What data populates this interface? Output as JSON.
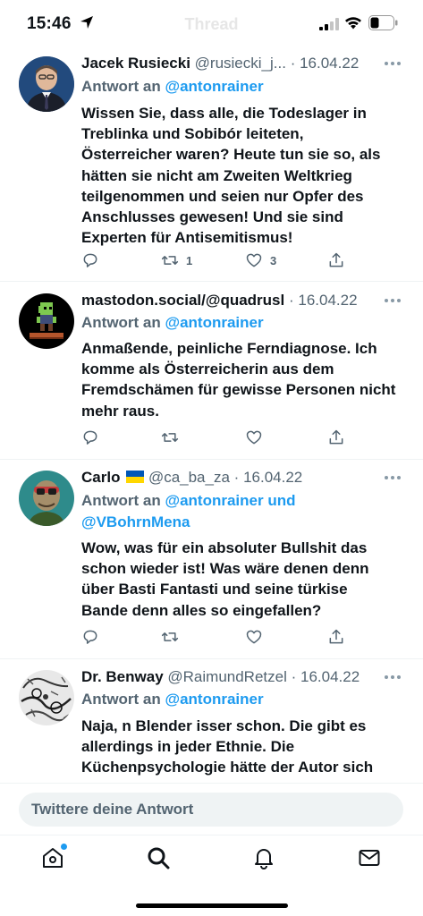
{
  "status_bar": {
    "time": "15:46",
    "ghost_title": "Thread"
  },
  "tweets": [
    {
      "name": "Jacek Rusiecki",
      "handle": "@rusiecki_j...",
      "separator": "·",
      "date": "16.04.22",
      "reply_prefix": "Antwort an",
      "reply_to": "@antonrainer",
      "lines": [
        "Wissen Sie, dass alle, die Todeslager in",
        "Treblinka und Sobibór leiteten,",
        "Österreicher waren? Heute tun sie so, als",
        "hätten sie nicht am Zweiten Weltkrieg",
        "teilgenommen und seien nur Opfer des",
        "Anschlusses gewesen! Und sie sind",
        "Experten für Antisemitismus!"
      ],
      "retweets": "1",
      "likes": "3"
    },
    {
      "name": "mastodon.social/@quadrusl",
      "separator": "·",
      "date": "16.04.22",
      "reply_prefix": "Antwort an",
      "reply_to": "@antonrainer",
      "lines": [
        "Anmaßende, peinliche Ferndiagnose. Ich",
        "komme als Österreicherin aus dem",
        "Fremdschämen für gewisse Personen nicht",
        "mehr raus."
      ]
    },
    {
      "name": "Carlo",
      "handle": "@ca_ba_za",
      "separator": "·",
      "date": "16.04.22",
      "reply_prefix": "Antwort an",
      "reply_to_line1": "@antonrainer und",
      "reply_to_line2": "@VBohrnMena",
      "lines": [
        "Wow, was für ein absoluter Bullshit das",
        "schon wieder ist! Was wäre denen denn",
        "über Basti Fantasti und seine türkise",
        "Bande denn alles so eingefallen?"
      ]
    },
    {
      "name": "Dr. Benway",
      "handle": "@RaimundRetzel",
      "separator": "·",
      "date": "16.04.22",
      "reply_prefix": "Antwort an",
      "reply_to": "@antonrainer",
      "lines": [
        "Naja, n Blender isser schon. Die gibt es",
        "allerdings in jeder Ethnie. Die",
        "Küchenpsychologie hätte der Autor sich"
      ]
    }
  ],
  "reply_bar": {
    "placeholder": "Twittere deine Antwort"
  },
  "tab_bar": {
    "tabs": [
      "home-icon",
      "search-icon",
      "bell-icon",
      "mail-icon"
    ]
  },
  "colors": {
    "accent": "#1d9bf0",
    "secondary_text": "#536471",
    "text": "#0f1419",
    "ukraine_blue": "#0057b7",
    "ukraine_yellow": "#ffd700"
  }
}
